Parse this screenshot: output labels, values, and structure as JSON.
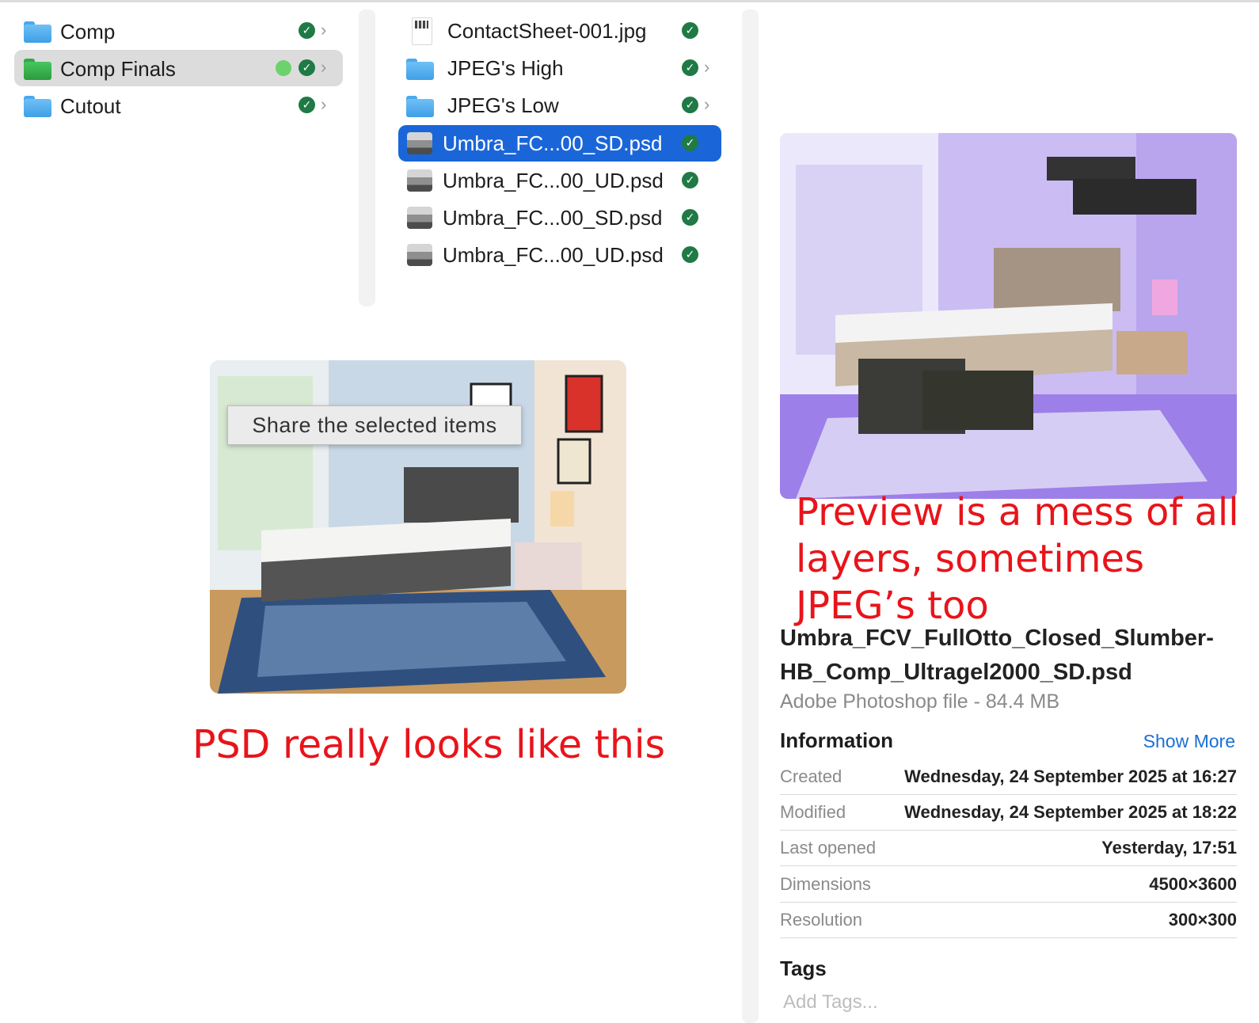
{
  "column1": {
    "items": [
      {
        "label": "Comp",
        "icon": "folder-blue-icon"
      },
      {
        "label": "Comp Finals",
        "icon": "folder-green-icon",
        "tag_color": "#6dd16c",
        "selected": true
      },
      {
        "label": "Cutout",
        "icon": "folder-blue-icon"
      }
    ]
  },
  "column2": {
    "items": [
      {
        "label": "ContactSheet-001.jpg"
      },
      {
        "label": "JPEG's High"
      },
      {
        "label": "JPEG's Low"
      },
      {
        "label": "Umbra_FC...00_SD.psd",
        "selected": true
      },
      {
        "label": "Umbra_FC...00_UD.psd"
      },
      {
        "label": "Umbra_FC...00_SD.psd"
      },
      {
        "label": "Umbra_FC...00_UD.psd"
      }
    ]
  },
  "tooltip": "Share the selected items",
  "annotations": {
    "left": "PSD really looks like this",
    "right": "Preview is a mess of all layers, sometimes JPEG’s too"
  },
  "info_panel": {
    "filename": "Umbra_FCV_FullOtto_Closed_Slumber-HB_Comp_Ultragel2000_SD.psd",
    "filetype": "Adobe Photoshop file - 84.4 MB",
    "section_title": "Information",
    "show_more": "Show More",
    "rows": [
      {
        "key": "Created",
        "value": "Wednesday, 24 September 2025 at 16:27"
      },
      {
        "key": "Modified",
        "value": "Wednesday, 24 September 2025 at 18:22"
      },
      {
        "key": "Last opened",
        "value": "Yesterday, 17:51"
      },
      {
        "key": "Dimensions",
        "value": "4500×3600"
      },
      {
        "key": "Resolution",
        "value": "300×300"
      }
    ],
    "tags_title": "Tags",
    "tags_placeholder": "Add Tags..."
  },
  "colors": {
    "accent": "#1a66d9",
    "annotation": "#e8141a",
    "sync_check": "#1f7a45"
  }
}
